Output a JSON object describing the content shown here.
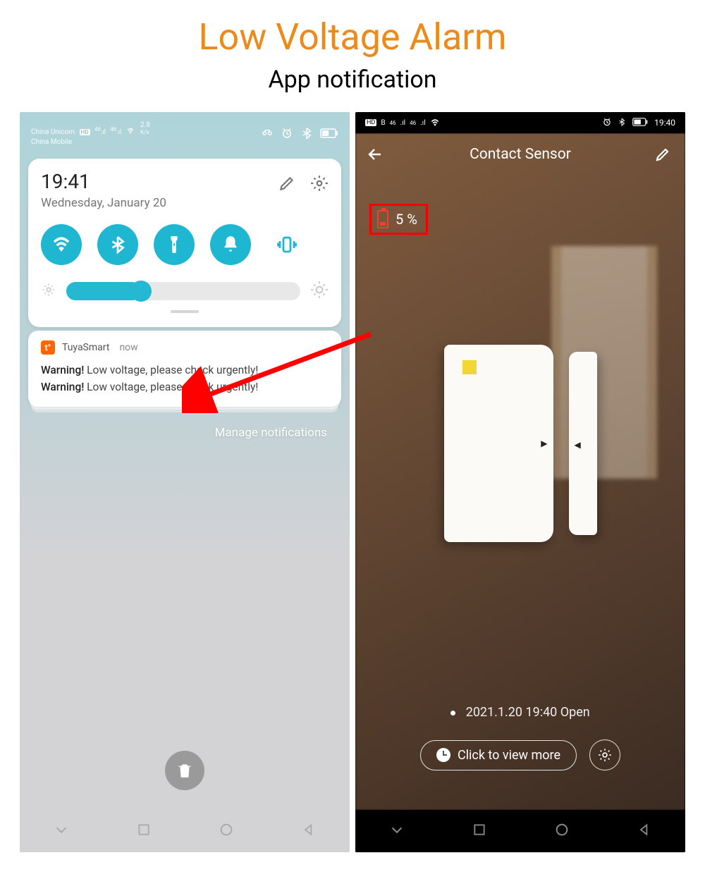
{
  "hero": {
    "title": "Low Voltage Alarm",
    "subtitle": "App notification"
  },
  "left": {
    "status": {
      "carrier1": "China Unicom",
      "carrier2": "China Mobile",
      "net_badge": "HD",
      "net_label": "46",
      "speed": "2.8",
      "speed_unit": "K/s"
    },
    "qs": {
      "time": "19:41",
      "date": "Wednesday, January 20",
      "brightness_pct": 32
    },
    "notification": {
      "app_name": "TuyaSmart",
      "time": "now",
      "line1_bold": "Warning!",
      "line1_rest": " Low voltage, please check urgently!",
      "line2_bold": "Warning!",
      "line2_rest": " Low voltage, please check urgently!"
    },
    "manage_label": "Manage notifications"
  },
  "right": {
    "status": {
      "hd": "HD",
      "net": "46",
      "time": "19:40"
    },
    "header": {
      "title": "Contact Sensor"
    },
    "battery": {
      "percent_label": "5 %"
    },
    "event": {
      "text": "2021.1.20 19:40 Open"
    },
    "actions": {
      "view_more": "Click to view more"
    }
  },
  "colors": {
    "accent_orange": "#ed8b1a",
    "toggle_teal": "#1fb6d1",
    "alert_red": "#f40000"
  }
}
